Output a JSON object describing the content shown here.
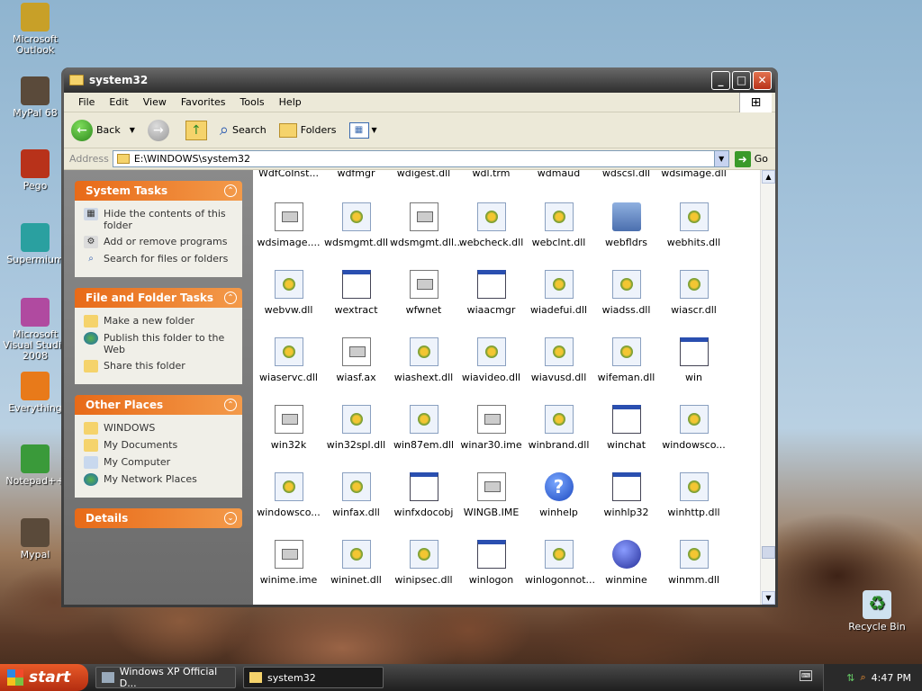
{
  "desktop": {
    "icons": [
      {
        "label": "Microsoft Outlook",
        "icon": "outlook-icon"
      },
      {
        "label": "MyPal 68",
        "icon": "raccoon-icon"
      },
      {
        "label": "Pego",
        "icon": "pego-icon"
      },
      {
        "label": "Supermium",
        "icon": "supermium-icon"
      },
      {
        "label": "Microsoft Visual Studio 2008",
        "icon": "visual-studio-icon"
      },
      {
        "label": "Everything",
        "icon": "everything-icon"
      },
      {
        "label": "Notepad++",
        "icon": "notepad-plus-icon"
      },
      {
        "label": "Mypal",
        "icon": "raccoon-icon"
      }
    ],
    "recycle_bin": "Recycle Bin"
  },
  "window": {
    "title": "system32",
    "menu": [
      "File",
      "Edit",
      "View",
      "Favorites",
      "Tools",
      "Help"
    ],
    "toolbar": {
      "back": "Back",
      "search": "Search",
      "folders": "Folders"
    },
    "address": {
      "label": "Address",
      "path": "E:\\WINDOWS\\system32",
      "go": "Go"
    }
  },
  "left_pane": {
    "system_tasks": {
      "title": "System Tasks",
      "items": [
        "Hide the contents of this folder",
        "Add or remove programs",
        "Search for files or folders"
      ]
    },
    "file_folder_tasks": {
      "title": "File and Folder Tasks",
      "items": [
        "Make a new folder",
        "Publish this folder to the Web",
        "Share this folder"
      ]
    },
    "other_places": {
      "title": "Other Places",
      "items": [
        "WINDOWS",
        "My Documents",
        "My Computer",
        "My Network Places"
      ]
    },
    "details": {
      "title": "Details"
    }
  },
  "files": {
    "partial_row": [
      "WdfCoInst...",
      "wdfmgr",
      "wdigest.dll",
      "wdl.trm",
      "wdmaud",
      "wdscsl.dll",
      "wdsimage.dll"
    ],
    "rows": [
      [
        {
          "n": "wdsimage....",
          "t": "doc"
        },
        {
          "n": "wdsmgmt.dll",
          "t": "dll"
        },
        {
          "n": "wdsmgmt.dll...",
          "t": "doc"
        },
        {
          "n": "webcheck.dll",
          "t": "dll"
        },
        {
          "n": "webclnt.dll",
          "t": "dll"
        },
        {
          "n": "webfldrs",
          "t": "fldr"
        },
        {
          "n": "webhits.dll",
          "t": "dll"
        }
      ],
      [
        {
          "n": "webvw.dll",
          "t": "dll"
        },
        {
          "n": "wextract",
          "t": "exe"
        },
        {
          "n": "wfwnet",
          "t": "doc"
        },
        {
          "n": "wiaacmgr",
          "t": "exe"
        },
        {
          "n": "wiadefui.dll",
          "t": "dll"
        },
        {
          "n": "wiadss.dll",
          "t": "dll"
        },
        {
          "n": "wiascr.dll",
          "t": "dll"
        }
      ],
      [
        {
          "n": "wiaservc.dll",
          "t": "dll"
        },
        {
          "n": "wiasf.ax",
          "t": "doc"
        },
        {
          "n": "wiashext.dll",
          "t": "dll"
        },
        {
          "n": "wiavideo.dll",
          "t": "dll"
        },
        {
          "n": "wiavusd.dll",
          "t": "dll"
        },
        {
          "n": "wifeman.dll",
          "t": "dll"
        },
        {
          "n": "win",
          "t": "exe"
        }
      ],
      [
        {
          "n": "win32k",
          "t": "doc"
        },
        {
          "n": "win32spl.dll",
          "t": "dll"
        },
        {
          "n": "win87em.dll",
          "t": "dll"
        },
        {
          "n": "winar30.ime",
          "t": "doc"
        },
        {
          "n": "winbrand.dll",
          "t": "dll"
        },
        {
          "n": "winchat",
          "t": "exe"
        },
        {
          "n": "windowsco...",
          "t": "dll"
        }
      ],
      [
        {
          "n": "windowsco...",
          "t": "dll"
        },
        {
          "n": "winfax.dll",
          "t": "dll"
        },
        {
          "n": "winfxdocobj",
          "t": "exe"
        },
        {
          "n": "WINGB.IME",
          "t": "doc"
        },
        {
          "n": "winhelp",
          "t": "help"
        },
        {
          "n": "winhlp32",
          "t": "exe"
        },
        {
          "n": "winhttp.dll",
          "t": "dll"
        }
      ],
      [
        {
          "n": "winime.ime",
          "t": "doc"
        },
        {
          "n": "wininet.dll",
          "t": "dll"
        },
        {
          "n": "winipsec.dll",
          "t": "dll"
        },
        {
          "n": "winlogon",
          "t": "exe"
        },
        {
          "n": "winlogonnot...",
          "t": "dll"
        },
        {
          "n": "winmine",
          "t": "mine"
        },
        {
          "n": "winmm.dll",
          "t": "dll"
        }
      ]
    ]
  },
  "taskbar": {
    "start": "start",
    "tasks": [
      "Windows XP Official D...",
      "system32"
    ],
    "clock": "4:47 PM"
  }
}
